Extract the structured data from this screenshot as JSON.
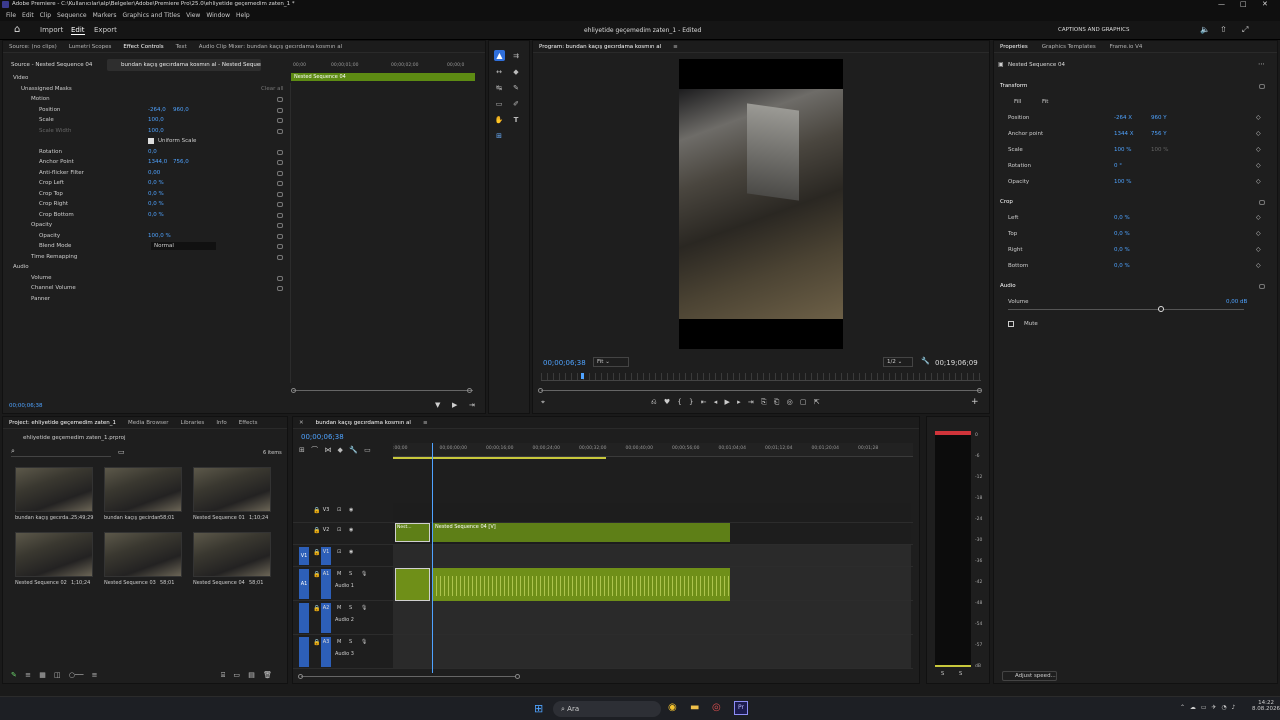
{
  "window": {
    "title": "Adobe Premiere - C:\\Kullanıcılar\\alp\\Belgeler\\Adobe\\Premiere Pro\\25.0\\ehliyetide geçemedim zaten_1 *"
  },
  "menu": [
    "File",
    "Edit",
    "Clip",
    "Sequence",
    "Markers",
    "Graphics and Titles",
    "View",
    "Window",
    "Help"
  ],
  "appbar": {
    "home": "home-icon",
    "tabs": [
      "Import",
      "Edit",
      "Export"
    ],
    "active_tab": "Edit",
    "project_title": "ehliyetide geçemedim zaten_1",
    "edited": " - Edited",
    "captions": "CAPTIONS AND GRAPHICS"
  },
  "source_panel": {
    "tabs": [
      "Source: (no clips)",
      "Lumetri Scopes",
      "Effect Controls",
      "Text",
      "Audio Clip Mixer: bundan kaçış gecırdama kosmın al"
    ],
    "active_tab": "Effect Controls",
    "subtab_source": "Source - Nested Sequence 04",
    "subtab_clip": "bundan kaçış gecırdama kosmın al - Nested Sequence 04",
    "mini_times": [
      "00;00",
      "00;00;01;00",
      "00;00;02;00",
      "00;00;0"
    ],
    "mini_clip": "Nested Sequence 04",
    "video_label": "Video",
    "unassigned": "Unassigned Masks",
    "clear_all": "Clear all",
    "motion": "Motion",
    "params": [
      {
        "name": "Position",
        "v1": "-264,0",
        "v2": "960,0"
      },
      {
        "name": "Scale",
        "v1": "100,0",
        "v2": ""
      },
      {
        "name": "Scale Width",
        "v1": "100,0",
        "v2": "",
        "dim": true
      },
      {
        "name": "Uniform Scale",
        "v1": "",
        "v2": "",
        "checkbox": true
      },
      {
        "name": "Rotation",
        "v1": "0,0",
        "v2": ""
      },
      {
        "name": "Anchor Point",
        "v1": "1344,0",
        "v2": "756,0"
      },
      {
        "name": "Anti-flicker Filter",
        "v1": "0,00",
        "v2": ""
      },
      {
        "name": "Crop Left",
        "v1": "0,0 %",
        "v2": ""
      },
      {
        "name": "Crop Top",
        "v1": "0,0 %",
        "v2": ""
      },
      {
        "name": "Crop Right",
        "v1": "0,0 %",
        "v2": ""
      },
      {
        "name": "Crop Bottom",
        "v1": "0,0 %",
        "v2": ""
      }
    ],
    "opacity_group": "Opacity",
    "opacity": {
      "name": "Opacity",
      "v1": "100,0 %"
    },
    "blend": {
      "name": "Blend Mode",
      "value": "Normal"
    },
    "time_remap": "Time Remapping",
    "audio_label": "Audio",
    "audio_items": [
      "Volume",
      "Channel Volume",
      "Panner"
    ],
    "timecode": "00;00;06;38"
  },
  "program": {
    "title": "Program: bundan kaçış gecırdama kosmın al",
    "timecode": "00;00;06;38",
    "fit": "Fit",
    "quality": "1/2",
    "duration": "00;19;06;09",
    "playhead_fraction": 0.09
  },
  "properties": {
    "tabs": [
      "Properties",
      "Graphics Templates",
      "Frame.io V4"
    ],
    "seq": "Nested Sequence 04",
    "transform": "Transform",
    "fill": "Fill",
    "fit": "Fit",
    "rows": [
      {
        "name": "Position",
        "v1": "-264 X",
        "v2": "960 Y"
      },
      {
        "name": "Anchor point",
        "v1": "1344 X",
        "v2": "756 Y"
      },
      {
        "name": "Scale",
        "v1": "100 %",
        "v2": "100 %"
      },
      {
        "name": "Rotation",
        "v1": "0 °",
        "v2": ""
      },
      {
        "name": "Opacity",
        "v1": "100 %",
        "v2": ""
      }
    ],
    "crop": "Crop",
    "crop_rows": [
      {
        "name": "Left",
        "v": "0,0 %"
      },
      {
        "name": "Top",
        "v": "0,0 %"
      },
      {
        "name": "Right",
        "v": "0,0 %"
      },
      {
        "name": "Bottom",
        "v": "0,0 %"
      }
    ],
    "audio": "Audio",
    "volume": {
      "name": "Volume",
      "v": "0,00 dB"
    },
    "mute": "Mute",
    "adjust": "Adjust speed..."
  },
  "project": {
    "tabs": [
      "Project: ehliyetide geçemedim zaten_1",
      "Media Browser",
      "Libraries",
      "Info",
      "Effects"
    ],
    "file": "ehliyetide geçemedim zaten_1.prproj",
    "count": "6 items",
    "items": [
      {
        "name": "bundan kaçış gecırda...",
        "dur": "25;49;29"
      },
      {
        "name": "bundan kaçış gecirdama ...",
        "dur": "58;01"
      },
      {
        "name": "Nested Sequence 01",
        "dur": "1;10;24"
      },
      {
        "name": "Nested Sequence 02",
        "dur": "1;10;24"
      },
      {
        "name": "Nested Sequence 03",
        "dur": "58;01"
      },
      {
        "name": "Nested Sequence 04",
        "dur": "58;01"
      }
    ]
  },
  "timeline": {
    "tab": "bundan kaçış gecırdama kosmın al",
    "timecode": "00;00;06;38",
    "ruler": [
      ":00;00",
      "00;00;00;00",
      "00;00;16;00",
      "00;00;24;00",
      "00;00;32;00",
      "00;00;40;00",
      "00;00;56;00",
      "00;01;04;04",
      "00;01;12;04",
      "00;01;20;04",
      "00;01;28"
    ],
    "tracks": [
      {
        "id": "V3",
        "name": ""
      },
      {
        "id": "V2",
        "name": ""
      },
      {
        "id": "V1",
        "name": ""
      },
      {
        "id": "A1",
        "name": "Audio 1"
      },
      {
        "id": "A2",
        "name": "Audio 2"
      },
      {
        "id": "A3",
        "name": "Audio 3"
      }
    ],
    "clip_small": "Nest...",
    "clip_main": "Nested Sequence 04 [V]"
  },
  "meter": {
    "scale": [
      "0",
      "-6",
      "-12",
      "-18",
      "-24",
      "-30",
      "-36",
      "-42",
      "-48",
      "-54",
      "-57",
      "dB"
    ],
    "channels": [
      "S",
      "S"
    ]
  },
  "taskbar": {
    "search": "Ara",
    "time": "14:22",
    "date": "8.08.2026"
  }
}
